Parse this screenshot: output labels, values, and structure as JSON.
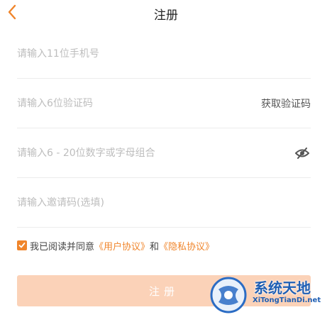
{
  "header": {
    "title": "注册",
    "back_icon": "chevron-left-icon"
  },
  "form": {
    "phone_placeholder": "请输入11位手机号",
    "code_placeholder": "请输入6位验证码",
    "get_code_label": "获取验证码",
    "password_placeholder": "请输入6 - 20位数字或字母组合",
    "password_visibility_icon": "eye-off-icon",
    "invite_placeholder": "请输入邀请码(选填)"
  },
  "agreement": {
    "prefix": "我已阅读并同意",
    "user_agreement": "《用户协议》",
    "conjunction": "和",
    "privacy_agreement": "《隐私协议》",
    "checked": true
  },
  "register_button": "注册",
  "watermark": {
    "name": "系统天地",
    "url": "XiTongTianDi.net"
  },
  "colors": {
    "accent": "#f0852b",
    "button_disabled": "#fbd2b8"
  }
}
